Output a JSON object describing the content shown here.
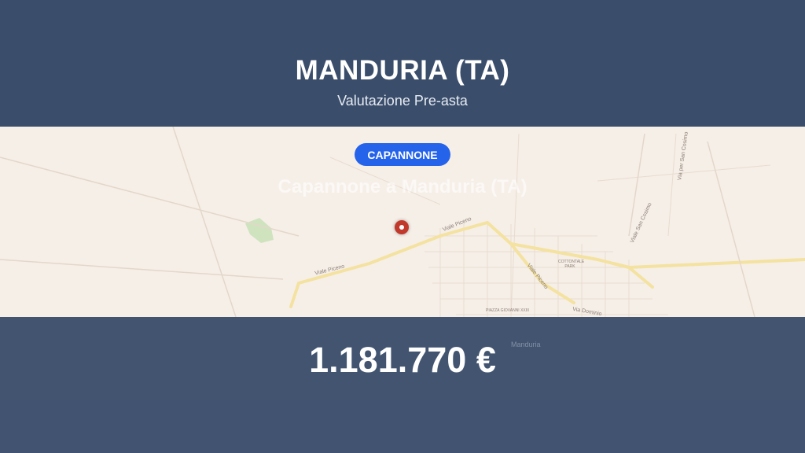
{
  "header": {
    "title": "MANDURIA (TA)",
    "subtitle": "Valutazione Pre-asta"
  },
  "badge": {
    "label": "CAPANNONE"
  },
  "headline": "Capannone a Manduria (TA)",
  "price": "1.181.770 €",
  "map": {
    "labels": {
      "viale_piceno_1": "Viale Piceno",
      "viale_piceno_2": "Viale Piceno",
      "viale_piceno_3": "Viale Piceno",
      "cotton": "COTTONTALE PARK",
      "piazza": "PIAZZA GIOVANNI XXIII",
      "via_dominio": "Via Dominio",
      "via_san_cosimo": "Via per San Cosimo",
      "viale_san_cosimo": "Viale San Cosimo",
      "manduria": "Manduria"
    },
    "colors": {
      "land": "#f6efe8",
      "road": "#f4e2a0",
      "park": "#cfe3bf",
      "band": "#3a4d6b",
      "badge": "#2563eb",
      "pin": "#c0392b"
    },
    "pin_icon": "location-pin-icon"
  }
}
